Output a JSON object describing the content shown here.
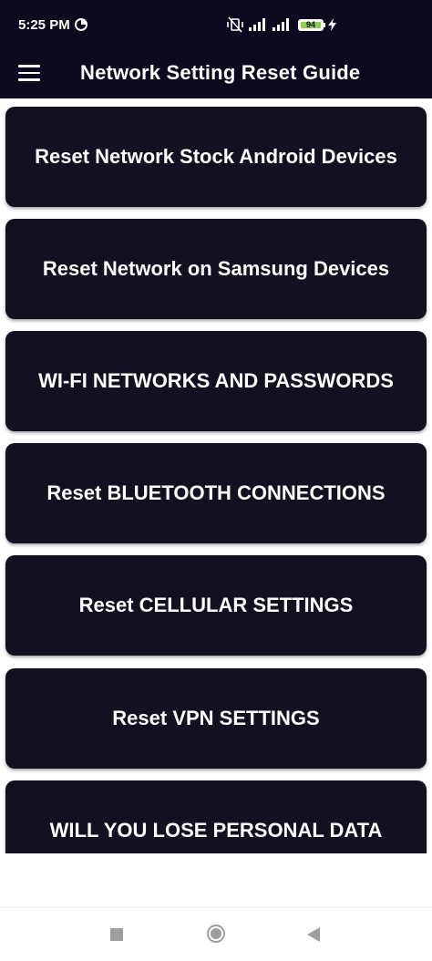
{
  "status": {
    "time": "5:25 PM",
    "battery_level": "94"
  },
  "appbar": {
    "title": "Network Setting Reset Guide"
  },
  "cards": [
    {
      "label": "Reset Network Stock Android Devices"
    },
    {
      "label": "Reset Network on Samsung Devices"
    },
    {
      "label": "WI-FI NETWORKS AND PASSWORDS"
    },
    {
      "label": "Reset BLUETOOTH CONNECTIONS"
    },
    {
      "label": "Reset CELLULAR SETTINGS"
    },
    {
      "label": "Reset VPN SETTINGS"
    },
    {
      "label": "WILL YOU LOSE PERSONAL DATA"
    }
  ],
  "colors": {
    "bar_background": "#0b0a1f",
    "card_background": "#13111f",
    "battery_fill": "#8fd14f"
  },
  "icons": {
    "menu": "hamburger-menu-icon",
    "nav_recents": "square-icon",
    "nav_home": "circle-icon",
    "nav_back": "triangle-back-icon"
  }
}
